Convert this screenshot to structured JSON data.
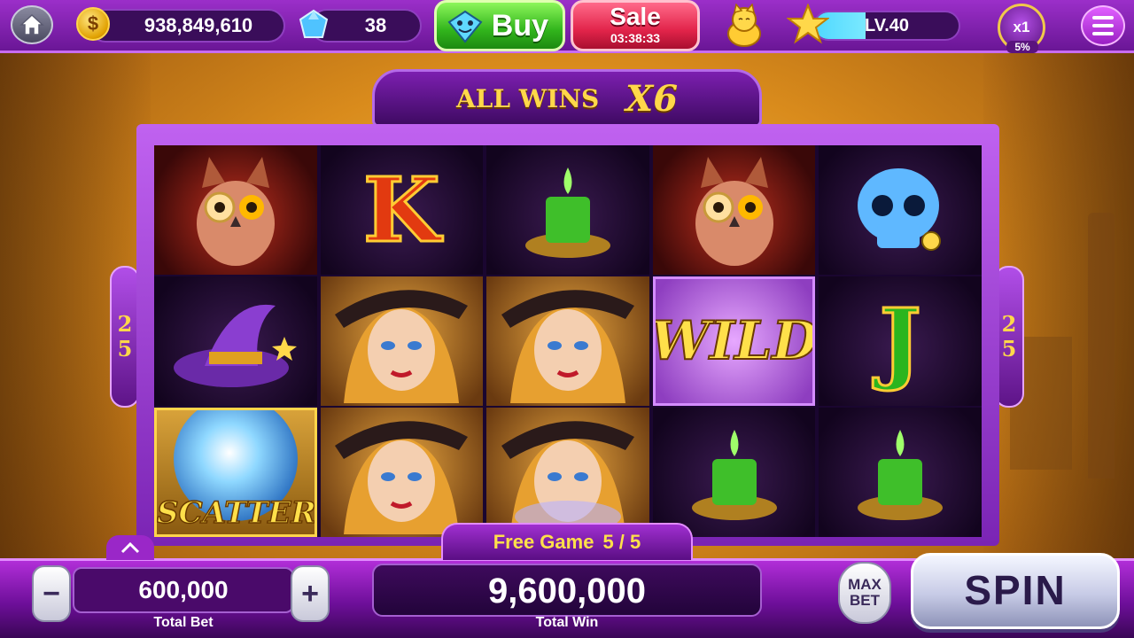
{
  "header": {
    "coins": "938,849,610",
    "coin_symbol": "$",
    "gems": "38",
    "buy_label": "Buy",
    "sale_label": "Sale",
    "sale_timer": "03:38:33",
    "level": "LV.40",
    "level_progress": 0.35,
    "multiplier": "x1",
    "multiplier_percent": "5%"
  },
  "banner": {
    "label": "ALL WINS",
    "multiplier": "X6"
  },
  "side_numbers": {
    "left": [
      "2",
      "5"
    ],
    "right": [
      "2",
      "5"
    ]
  },
  "reels": [
    [
      {
        "symbol": "owl-icon",
        "text": ""
      },
      {
        "symbol": "witch-hat-icon",
        "text": ""
      },
      {
        "symbol": "scatter-crystal-ball-icon",
        "text": "SCATTER"
      }
    ],
    [
      {
        "symbol": "letter-k",
        "text": "K"
      },
      {
        "symbol": "witch-icon",
        "text": ""
      },
      {
        "symbol": "witch-icon",
        "text": ""
      }
    ],
    [
      {
        "symbol": "candle-icon",
        "text": ""
      },
      {
        "symbol": "witch-icon",
        "text": ""
      },
      {
        "symbol": "witch-icon",
        "text": ""
      }
    ],
    [
      {
        "symbol": "owl-icon",
        "text": ""
      },
      {
        "symbol": "wild",
        "text": "WILD"
      },
      {
        "symbol": "candle-icon",
        "text": ""
      }
    ],
    [
      {
        "symbol": "skull-icon",
        "text": ""
      },
      {
        "symbol": "letter-j",
        "text": "J"
      },
      {
        "symbol": "candle-icon",
        "text": ""
      }
    ]
  ],
  "free_game": {
    "label": "Free Game",
    "progress": "5 / 5"
  },
  "bet": {
    "value": "600,000",
    "caption": "Total Bet",
    "minus_label": "−",
    "plus_label": "+"
  },
  "win": {
    "value": "9,600,000",
    "caption": "Total Win"
  },
  "maxbet": {
    "line1": "MAX",
    "line2": "BET"
  },
  "spin_label": "SPIN",
  "colors": {
    "accent_purple": "#9b2fc9",
    "gold_text": "#ffd84a",
    "buy_green": "#31b41c",
    "sale_red": "#e2244a"
  }
}
